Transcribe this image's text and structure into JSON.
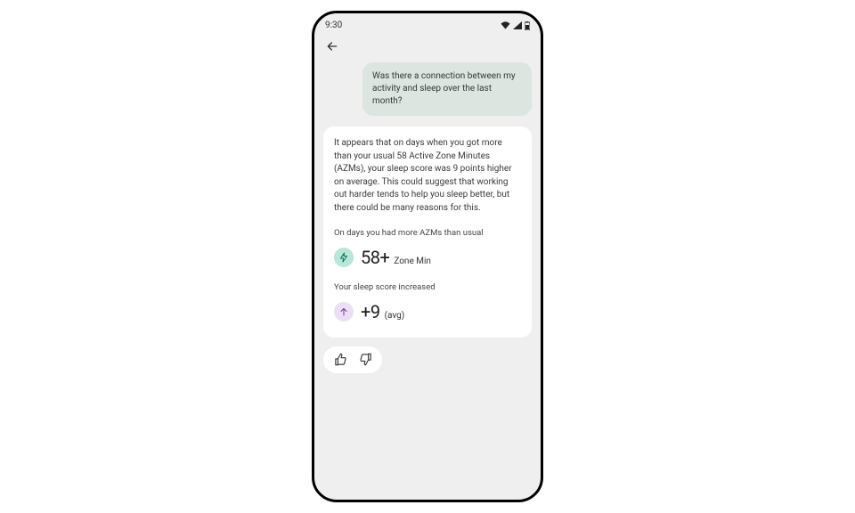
{
  "status": {
    "time": "9:30"
  },
  "chat": {
    "user_message": "Was there a connection between my activity and sleep over the last month?",
    "assistant_lead": "It appears that on days when you got more than your usual 58 Active Zone Minutes (AZMs), your sleep score was 9 points higher on average. This could suggest that working out harder tends to help you sleep better, but there could be many reasons for this."
  },
  "stats": {
    "azm": {
      "label": "On days you had more AZMs than usual",
      "value": "58+",
      "unit": "Zone Min"
    },
    "sleep": {
      "label": "Your sleep score increased",
      "value": "+9",
      "unit": "(avg)"
    }
  }
}
